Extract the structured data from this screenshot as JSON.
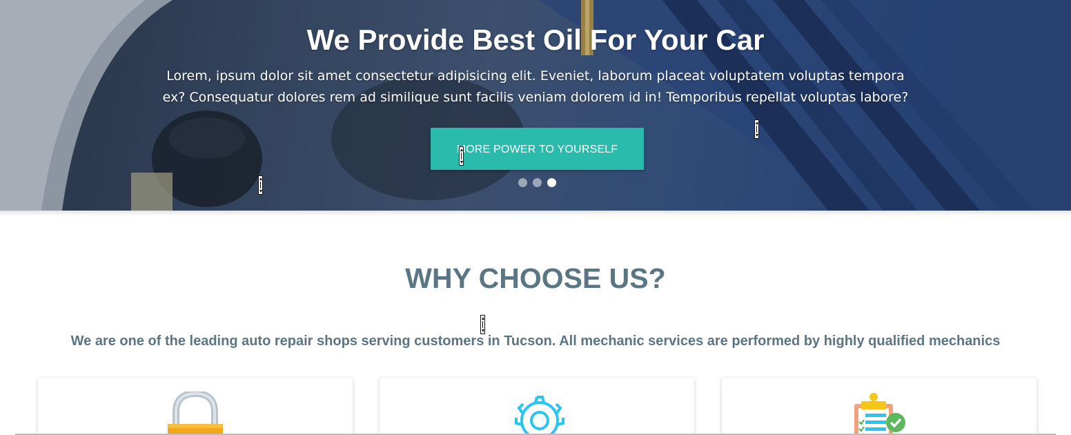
{
  "hero": {
    "title": "We Provide Best Oil For Your Car",
    "text": "Lorem, ipsum dolor sit amet consectetur adipisicing elit. Eveniet, laborum placeat voluptatem voluptas tempora ex? Consequatur dolores rem ad similique sunt facilis veniam dolorem id in! Temporibus repellat voluptas labore?",
    "button_label": "MORE POWER TO YOURSELF",
    "slides_total": 3,
    "active_slide": 3,
    "background_image": "car-engine-oil-photo"
  },
  "why": {
    "title": "WHY CHOOSE US?",
    "subtitle": "We are one of the leading auto repair shops serving customers in Tucson. All mechanic services are performed by highly qualified mechanics",
    "cards": [
      {
        "icon": "padlock-icon"
      },
      {
        "icon": "gear-icon"
      },
      {
        "icon": "clipboard-check-icon"
      }
    ]
  },
  "colors": {
    "accent": "#2bbbad",
    "heading": "#5a7584",
    "white": "#ffffff"
  }
}
